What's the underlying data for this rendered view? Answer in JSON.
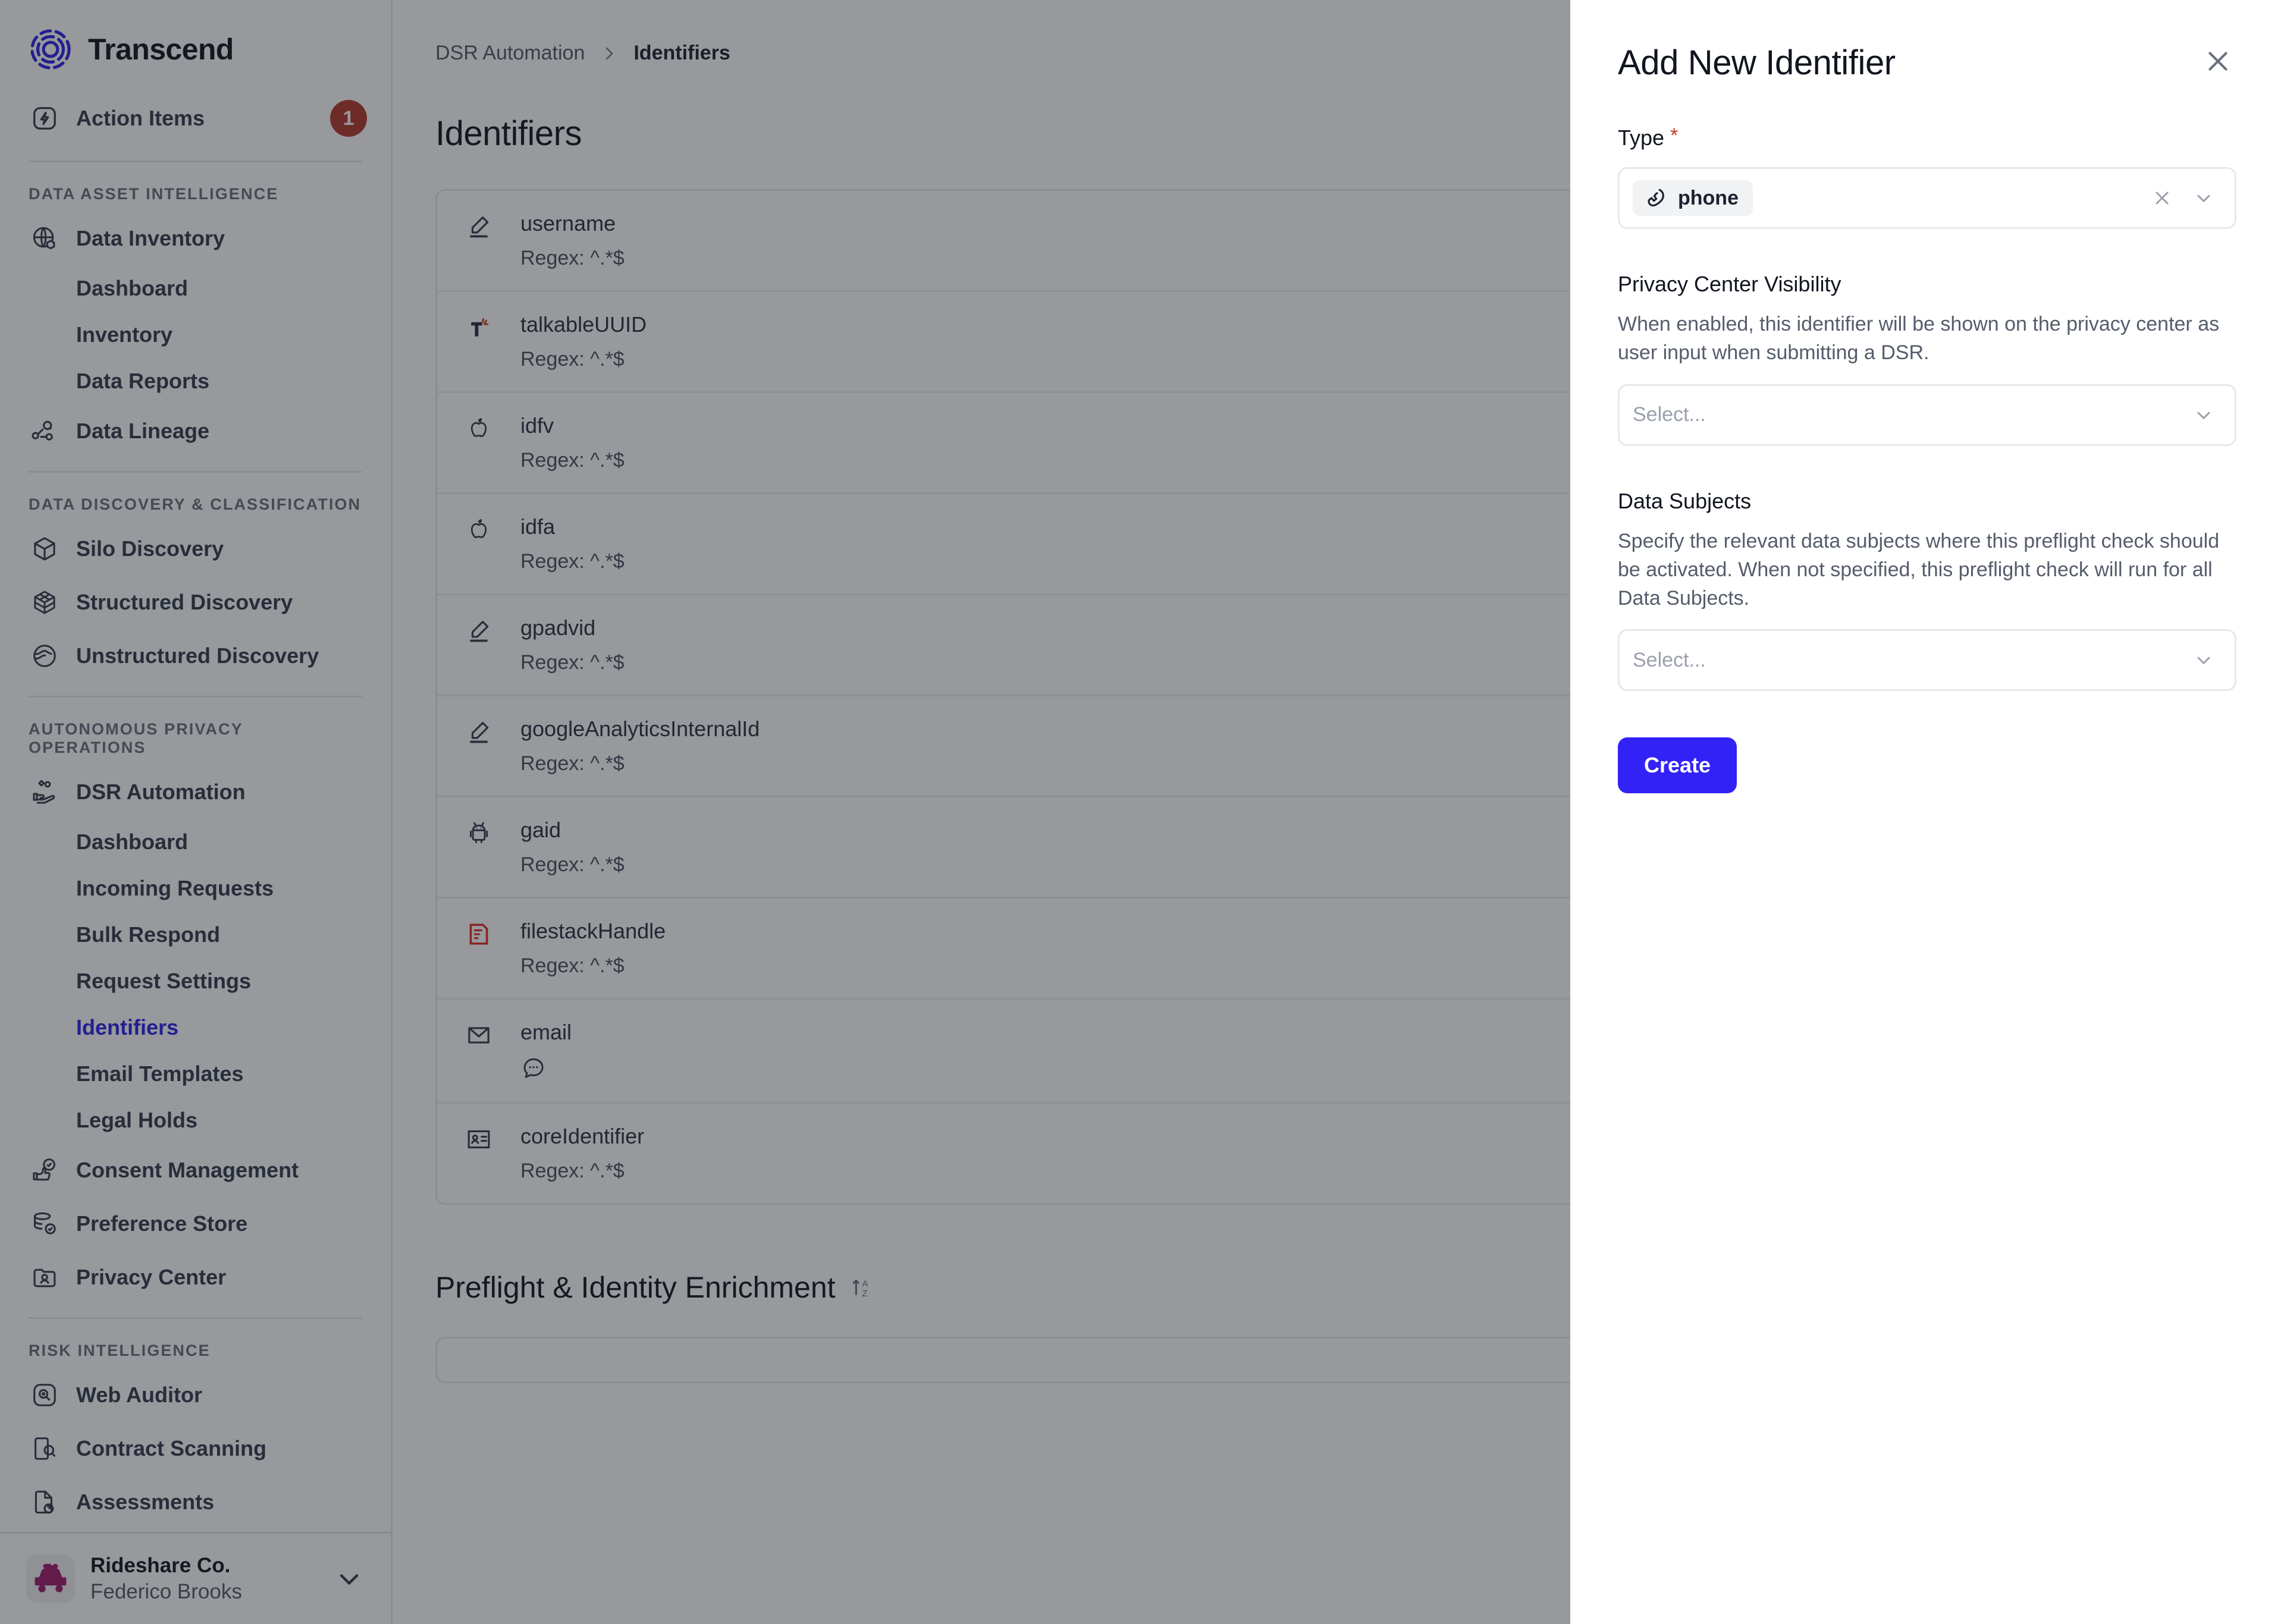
{
  "brand": {
    "name": "Transcend",
    "logo_icon": "transcend-logo-icon",
    "accent": "#2f22e8"
  },
  "sidebar": {
    "action_items": {
      "label": "Action Items",
      "badge": "1",
      "icon": "bolt-square-icon",
      "badge_color": "#b5392c"
    },
    "groups": [
      {
        "title": "DATA ASSET INTELLIGENCE",
        "items": [
          {
            "label": "Data Inventory",
            "icon": "globe-box-icon",
            "level": "top",
            "active": false
          },
          {
            "label": "Dashboard",
            "icon": "",
            "level": "sub",
            "active": false
          },
          {
            "label": "Inventory",
            "icon": "",
            "level": "sub",
            "active": false
          },
          {
            "label": "Data Reports",
            "icon": "",
            "level": "sub",
            "active": false
          },
          {
            "label": "Data Lineage",
            "icon": "lineage-nodes-icon",
            "level": "top",
            "active": false
          }
        ]
      },
      {
        "title": "DATA DISCOVERY & CLASSIFICATION",
        "items": [
          {
            "label": "Silo Discovery",
            "icon": "cube-icon",
            "level": "top",
            "active": false
          },
          {
            "label": "Structured Discovery",
            "icon": "grid-cube-icon",
            "level": "top",
            "active": false
          },
          {
            "label": "Unstructured Discovery",
            "icon": "globe-swirl-icon",
            "level": "top",
            "active": false
          }
        ]
      },
      {
        "title": "AUTONOMOUS PRIVACY OPERATIONS",
        "items": [
          {
            "label": "DSR Automation",
            "icon": "hand-data-icon",
            "level": "top",
            "active": false
          },
          {
            "label": "Dashboard",
            "icon": "",
            "level": "sub",
            "active": false
          },
          {
            "label": "Incoming Requests",
            "icon": "",
            "level": "sub",
            "active": false
          },
          {
            "label": "Bulk Respond",
            "icon": "",
            "level": "sub",
            "active": false
          },
          {
            "label": "Request Settings",
            "icon": "",
            "level": "sub",
            "active": false
          },
          {
            "label": "Identifiers",
            "icon": "",
            "level": "sub",
            "active": true
          },
          {
            "label": "Email Templates",
            "icon": "",
            "level": "sub",
            "active": false
          },
          {
            "label": "Legal Holds",
            "icon": "",
            "level": "sub",
            "active": false
          },
          {
            "label": "Consent Management",
            "icon": "thumbs-up-check-icon",
            "level": "top",
            "active": false
          },
          {
            "label": "Preference Store",
            "icon": "database-check-icon",
            "level": "top",
            "active": false
          },
          {
            "label": "Privacy Center",
            "icon": "id-card-icon",
            "level": "top",
            "active": false
          }
        ]
      },
      {
        "title": "RISK INTELLIGENCE",
        "items": [
          {
            "label": "Web Auditor",
            "icon": "magnify-square-icon",
            "level": "top",
            "active": false
          },
          {
            "label": "Contract Scanning",
            "icon": "document-magnify-icon",
            "level": "top",
            "active": false
          },
          {
            "label": "Assessments",
            "icon": "document-question-icon",
            "level": "top",
            "active": false
          }
        ]
      }
    ],
    "account": {
      "org": "Rideshare Co.",
      "user": "Federico Brooks",
      "avatar_icon": "rideshare-car-icon",
      "chevron_icon": "chevron-down-icon",
      "avatar_color": "#a01a6e"
    }
  },
  "main": {
    "breadcrumb": {
      "parent": "DSR Automation",
      "separator": "›",
      "current": "Identifiers"
    },
    "page_title": "Identifiers",
    "identifiers": [
      {
        "name": "username",
        "regex": "Regex: ^.*$",
        "icon": "pencil-icon"
      },
      {
        "name": "talkableUUID",
        "regex": "Regex: ^.*$",
        "icon": "talkable-logo-icon"
      },
      {
        "name": "idfv",
        "regex": "Regex: ^.*$",
        "icon": "apple-icon"
      },
      {
        "name": "idfa",
        "regex": "Regex: ^.*$",
        "icon": "apple-icon"
      },
      {
        "name": "gpadvid",
        "regex": "Regex: ^.*$",
        "icon": "pencil-icon"
      },
      {
        "name": "googleAnalyticsInternalId",
        "regex": "Regex: ^.*$",
        "icon": "pencil-icon"
      },
      {
        "name": "gaid",
        "regex": "Regex: ^.*$",
        "icon": "android-icon"
      },
      {
        "name": "filestackHandle",
        "regex": "Regex: ^.*$",
        "icon": "filestack-icon"
      },
      {
        "name": "email",
        "regex": "",
        "icon": "envelope-icon",
        "badge_icon": "speech-dots-icon"
      },
      {
        "name": "coreIdentifier",
        "regex": "Regex: ^.*$",
        "icon": "contact-card-icon"
      }
    ],
    "section": {
      "title": "Preflight & Identity Enrichment",
      "sort_icon": "sort-az-icon"
    }
  },
  "drawer": {
    "title": "Add New Identifier",
    "close_icon": "close-icon",
    "type": {
      "label": "Type",
      "required_marker": "*",
      "value": "phone",
      "value_icon": "phone-icon",
      "clear_icon": "clear-x-icon",
      "chevron_icon": "chevron-down-icon"
    },
    "privacy_center_visibility": {
      "label": "Privacy Center Visibility",
      "description": "When enabled, this identifier will be shown on the privacy center as user input when submitting a DSR.",
      "placeholder": "Select...",
      "chevron_icon": "chevron-down-icon"
    },
    "data_subjects": {
      "label": "Data Subjects",
      "description": "Specify the relevant data subjects where this preflight check should be activated. When not specified, this preflight check will run for all Data Subjects.",
      "placeholder": "Select...",
      "chevron_icon": "chevron-down-icon"
    },
    "create_button": {
      "label": "Create",
      "color": "#3322f5"
    }
  }
}
